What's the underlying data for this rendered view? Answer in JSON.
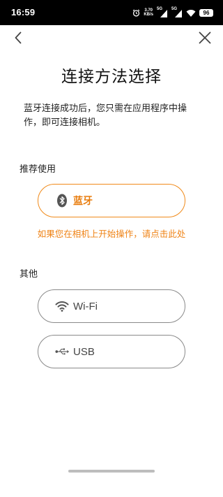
{
  "status_bar": {
    "time": "16:59",
    "net_speed_value": "3.70",
    "net_speed_unit": "KB/s",
    "signal1_label": "5G",
    "signal2_label": "5G",
    "battery": "96"
  },
  "header": {
    "title": "连接方法选择",
    "description": "蓝牙连接成功后，您只需在应用程序中操作，即可连接相机。"
  },
  "recommended": {
    "label": "推荐使用",
    "bluetooth_label": "蓝牙",
    "hint": "如果您在相机上开始操作，请点击此处"
  },
  "other": {
    "label": "其他",
    "wifi_label": "Wi-Fi",
    "usb_label": "USB"
  },
  "colors": {
    "accent": "#f08a1a",
    "hint": "#ef8316",
    "border_gray": "#8a8a8a"
  },
  "icons": {
    "back": "chevron-left-icon",
    "close": "close-icon",
    "bluetooth": "bluetooth-icon",
    "wifi": "wifi-icon",
    "usb": "usb-icon"
  }
}
